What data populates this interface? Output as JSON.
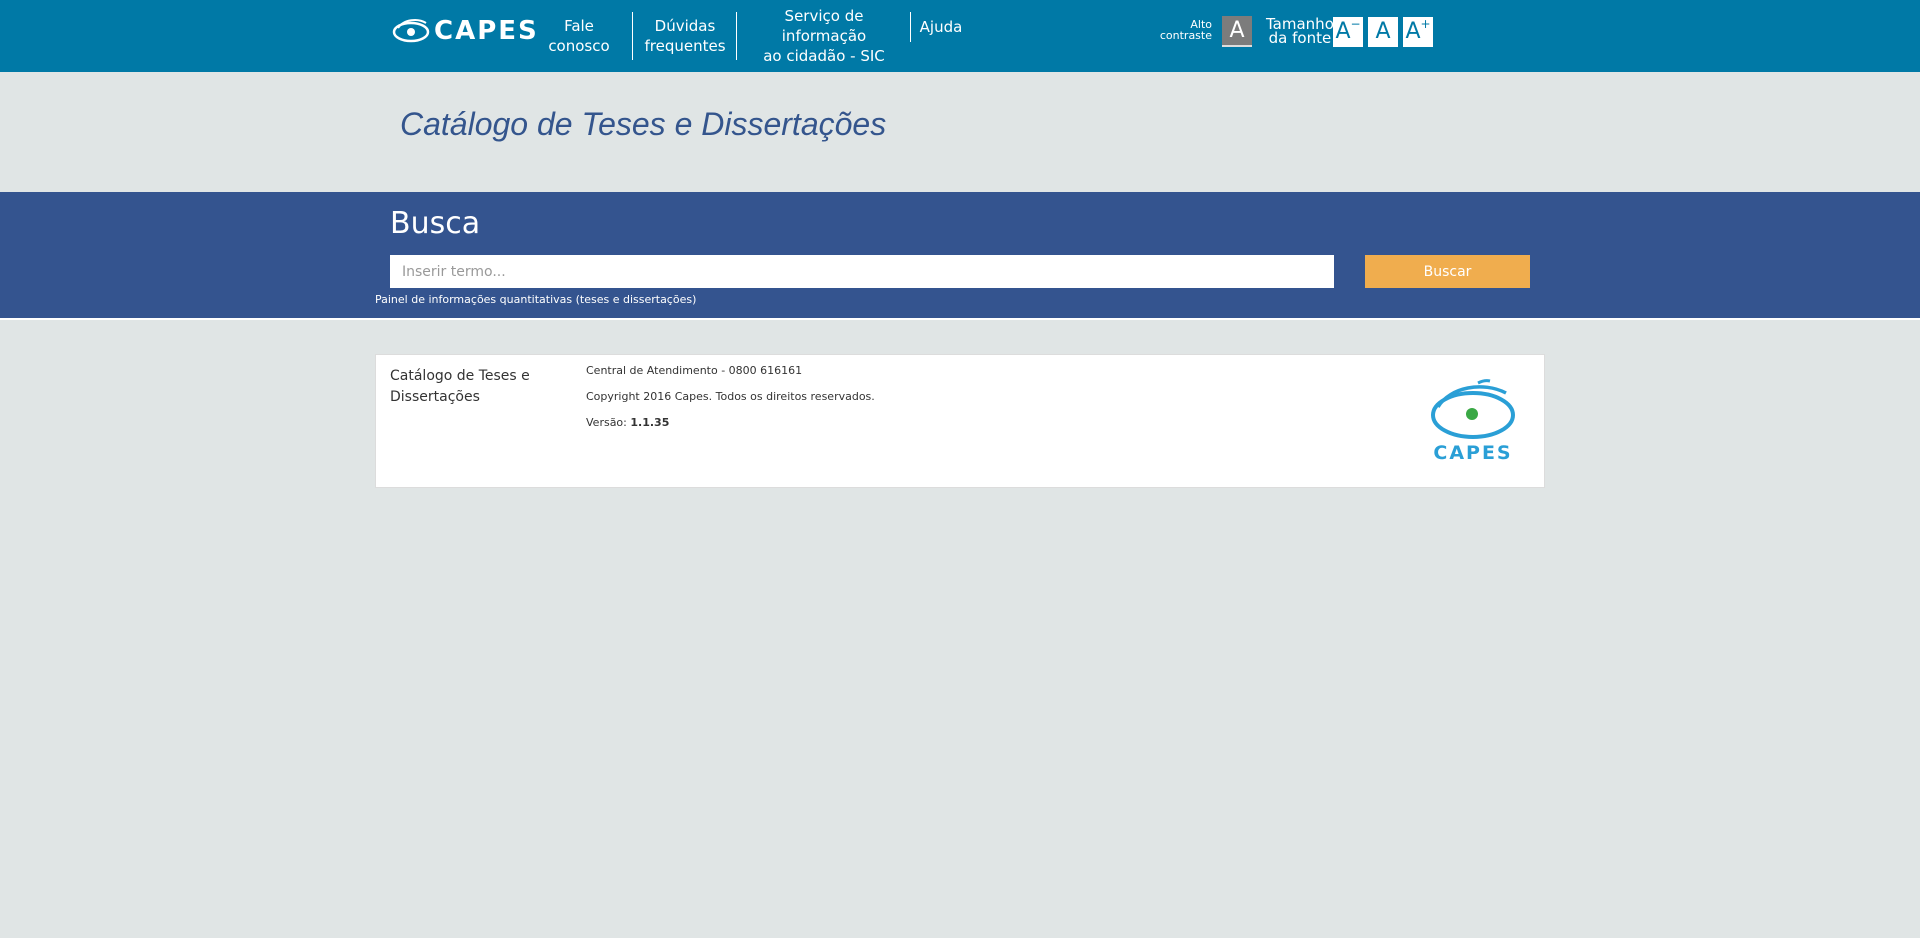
{
  "header": {
    "logo_text": "CAPES",
    "nav": [
      {
        "line1": "Fale",
        "line2": "conosco"
      },
      {
        "line1": "Dúvidas",
        "line2": "frequentes"
      },
      {
        "line1": "Serviço de informação",
        "line2": "ao cidadão - SIC"
      },
      {
        "line1": "Ajuda",
        "line2": ""
      }
    ],
    "contrast": {
      "line1": "Alto",
      "line2": "contraste",
      "button": "A"
    },
    "font_size": {
      "line1": "Tamanho",
      "line2": "da fonte",
      "decrease": "A",
      "decrease_sign": "−",
      "reset": "A",
      "increase": "A",
      "increase_sign": "+"
    }
  },
  "page_title": "Catálogo de Teses e Dissertações",
  "search": {
    "heading": "Busca",
    "placeholder": "Inserir termo...",
    "value": "",
    "button": "Buscar",
    "panel_link": "Painel de informações quantitativas (teses e dissertações)"
  },
  "footer": {
    "title": "Catálogo de Teses e Dissertações",
    "support": "Central de Atendimento - 0800 616161",
    "copyright": "Copyright 2016 Capes. Todos os direitos reservados.",
    "version_label": "Versão: ",
    "version": "1.1.35",
    "logo_text": "CAPES"
  },
  "colors": {
    "header_bg": "#0079a6",
    "search_bg": "#34548f",
    "title_color": "#34558d",
    "button_bg": "#f0ad4e",
    "page_bg": "#e0e5e5",
    "logo_blue": "#2a9fd6",
    "logo_green": "#3aa845"
  }
}
